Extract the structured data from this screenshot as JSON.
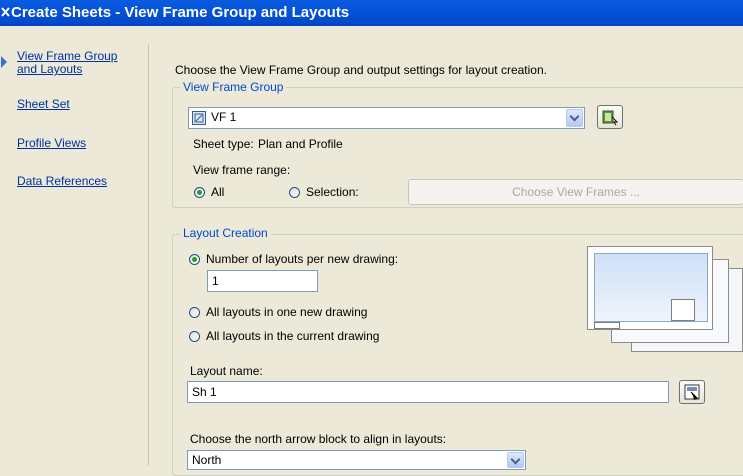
{
  "window": {
    "title": "Create Sheets - View Frame Group and Layouts"
  },
  "nav": {
    "items": [
      {
        "label": "View Frame Group and Layouts"
      },
      {
        "label": "Sheet Set"
      },
      {
        "label": "Profile Views"
      },
      {
        "label": "Data References"
      }
    ]
  },
  "intro": "Choose the View Frame Group and output settings for layout creation.",
  "view_frame_group": {
    "label": "View Frame Group",
    "selected": "VF 1",
    "sheet_type_label": "Sheet type:",
    "sheet_type_value": "Plan and Profile",
    "range_label": "View frame range:",
    "radio_all": "All",
    "radio_selection": "Selection:",
    "choose_button": "Choose View Frames ..."
  },
  "layout_creation": {
    "label": "Layout Creation",
    "option_per_drawing": "Number of layouts per new drawing:",
    "per_drawing_value": "1",
    "option_one_drawing": "All layouts in one new drawing",
    "option_current_drawing": "All layouts in the current drawing",
    "selected_option": "Number of layouts per new drawing",
    "layout_name_label": "Layout name:",
    "layout_name_value": "Sh 1",
    "north_arrow_label": "Choose the north arrow block to align in layouts:",
    "north_arrow_value": "North"
  }
}
